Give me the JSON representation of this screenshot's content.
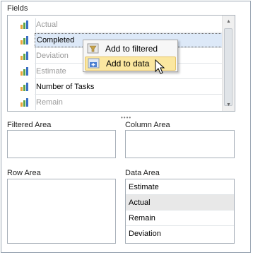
{
  "fields": {
    "label": "Fields",
    "items": [
      {
        "name": "Actual",
        "style": "gray"
      },
      {
        "name": "Completed",
        "style": "selected"
      },
      {
        "name": "Deviation",
        "style": "gray"
      },
      {
        "name": "Estimate",
        "style": "gray"
      },
      {
        "name": "Number of Tasks",
        "style": "normal"
      },
      {
        "name": "Remain",
        "style": "gray"
      }
    ]
  },
  "context_menu": {
    "add_to_filtered": "Add to filtered",
    "add_to_data": "Add to data"
  },
  "areas": {
    "filtered": "Filtered Area",
    "column": "Column Area",
    "row": "Row Area",
    "data": "Data Area"
  },
  "data_area_items": [
    "Estimate",
    "Actual",
    "Remain",
    "Deviation"
  ],
  "colors": {
    "border": "#a8b0b9",
    "selection": "#dde9f8",
    "menu_hover": "#fbe7a0",
    "highlight_row": "#e8e8e8"
  }
}
